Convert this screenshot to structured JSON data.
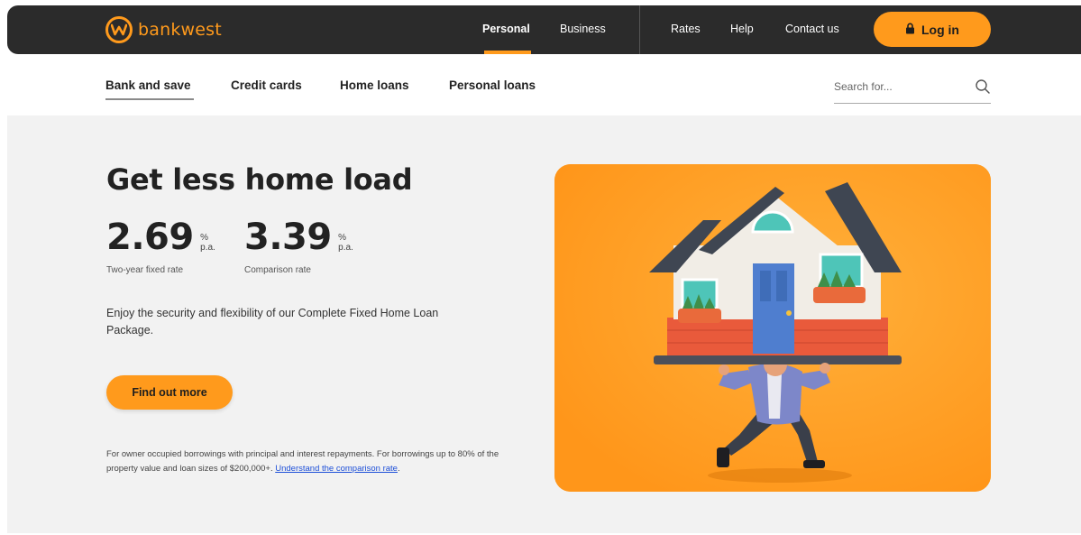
{
  "brand": {
    "name": "bankwest",
    "color": "#ff9a1c"
  },
  "topnav": {
    "segments": [
      "Personal",
      "Business"
    ],
    "links": [
      "Rates",
      "Help",
      "Contact us"
    ],
    "login_label": "Log in",
    "login_icon": "lock-icon"
  },
  "subnav": {
    "items": [
      "Bank and save",
      "Credit cards",
      "Home loans",
      "Personal loans"
    ],
    "active": "Bank and save",
    "search": {
      "placeholder": "Search for...",
      "icon": "search-icon"
    }
  },
  "hero": {
    "title": "Get less home load",
    "rates": [
      {
        "value": "2.69",
        "unit_top": "%",
        "unit_bottom": "p.a.",
        "label": "Two-year fixed rate"
      },
      {
        "value": "3.39",
        "unit_top": "%",
        "unit_bottom": "p.a.",
        "label": "Comparison rate"
      }
    ],
    "description": "Enjoy the security and flexibility of our Complete Fixed Home Loan Package.",
    "cta_label": "Find out more",
    "disclaimer": "For owner occupied borrowings with principal and interest repayments. For borrowings up to 80% of the property value and loan sizes of $200,000+.",
    "disclaimer_link": "Understand the comparison rate",
    "disclaimer_end": ".",
    "image": "man-lifting-house-illustration"
  }
}
